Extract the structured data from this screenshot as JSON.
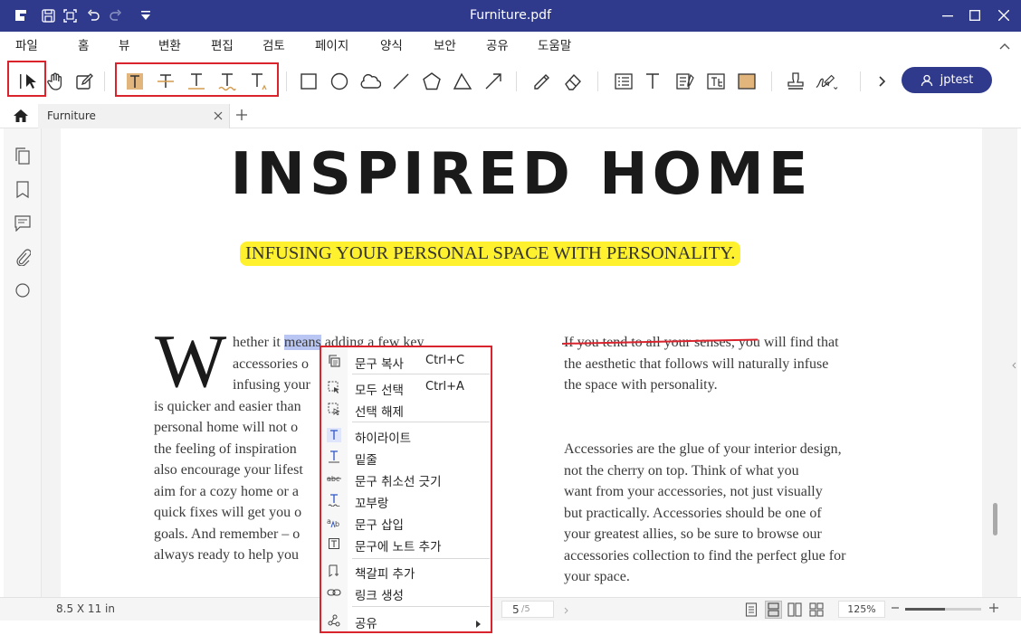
{
  "window": {
    "title": "Furniture.pdf"
  },
  "menu": [
    "파일",
    "홈",
    "뷰",
    "변환",
    "편집",
    "검토",
    "페이지",
    "양식",
    "보안",
    "공유",
    "도움말"
  ],
  "menu_active": "검토",
  "user": {
    "name": "jptest"
  },
  "tab": {
    "label": "Furniture"
  },
  "document": {
    "headline": "INSPIRED HOME",
    "subheadline": "INFUSING YOUR PERSONAL SPACE WITH PERSONALITY.",
    "dropcap": "W",
    "left_lines": [
      "hether it ",
      "accessories o",
      "infusing your",
      "is quicker and easier than",
      "personal home will not o",
      "the feeling of inspiration",
      "also encourage your lifest",
      "aim for a cozy home or a",
      "quick fixes will get you o",
      "goals. And remember – o",
      "always ready to help you"
    ],
    "left_selected": "means",
    "left_line1_tail": " adding a few key",
    "right_p1_struck": "If you tend to all your senses,",
    "right_p1_lines": [
      " you will find that",
      "the aesthetic that follows will naturally infuse",
      "the space with personality."
    ],
    "right_p2_lines": [
      "Accessories are the glue of your interior design,",
      "not the cherry on top. Think of what you",
      "want from your accessories, not just visually",
      "but practically. Accessories should be one of",
      "your greatest allies, so be sure to browse our",
      "accessories collection to find the perfect glue for",
      "your space."
    ]
  },
  "context_menu": {
    "copy": "문구 복사",
    "copy_sc": "Ctrl+C",
    "select_all": "모두 선택",
    "select_all_sc": "Ctrl+A",
    "deselect": "선택 해제",
    "highlight": "하이라이트",
    "underline": "밑줄",
    "strikethrough": "문구 취소선 긋기",
    "squiggly": "꼬부랑",
    "insert_text": "문구 삽입",
    "add_note": "문구에 노트 추가",
    "add_bookmark": "책갈피 추가",
    "create_link": "링크 생성",
    "share": "공유"
  },
  "status": {
    "page_size": "8.5 X 11 in",
    "page_current": "5",
    "page_total": "/5",
    "zoom": "125%"
  },
  "colors": {
    "titlebar": "#2f3a8c",
    "highlight_box": "#d9232d",
    "subhead_highlight": "#fff12e",
    "selection": "#b9c6f4"
  }
}
